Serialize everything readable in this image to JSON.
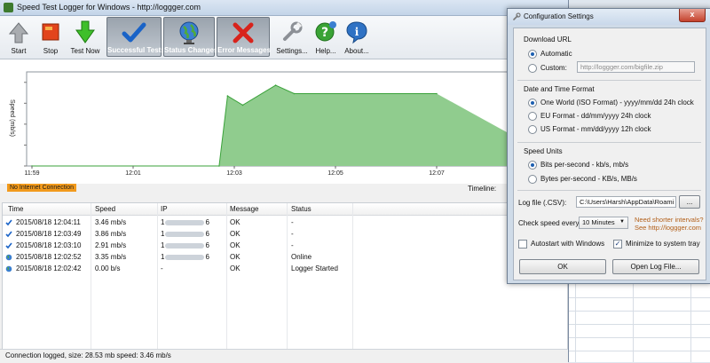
{
  "app": {
    "title": "Speed Test Logger for Windows - http://loggger.com"
  },
  "toolbar": {
    "buttons": [
      {
        "label": "Start",
        "icon": "start-icon"
      },
      {
        "label": "Stop",
        "icon": "stop-icon"
      },
      {
        "label": "Test Now",
        "icon": "test-now-icon"
      },
      {
        "label": "Successful Tests",
        "icon": "checkmark-icon"
      },
      {
        "label": "Status Changes",
        "icon": "globe-icon"
      },
      {
        "label": "Error Messages",
        "icon": "red-x-icon"
      },
      {
        "label": "Settings...",
        "icon": "wrench-icon"
      },
      {
        "label": "Help...",
        "icon": "help-icon"
      },
      {
        "label": "About...",
        "icon": "info-icon"
      }
    ]
  },
  "chart_data": {
    "type": "area",
    "ylabel": "Speed (mb/s)",
    "x": [
      "11:59",
      "12:01",
      "12:02:42",
      "12:02:52",
      "12:03:10",
      "12:03:49",
      "12:04:11",
      "12:05",
      "12:07"
    ],
    "x_ticks": [
      "11:59",
      "12:01",
      "12:03",
      "12:05",
      "12:07"
    ],
    "points": [
      {
        "t": "11:59",
        "v": 0
      },
      {
        "t": "12:02:42",
        "v": 0
      },
      {
        "t": "12:02:52",
        "v": 3.35
      },
      {
        "t": "12:03:10",
        "v": 2.91
      },
      {
        "t": "12:03:49",
        "v": 3.86
      },
      {
        "t": "12:04:11",
        "v": 3.46
      },
      {
        "t": "12:07",
        "v": 3.46
      }
    ],
    "ylim": [
      0,
      4.5
    ],
    "grid": false,
    "fill_color": "#90cc8e",
    "line_color": "#3aa23a"
  },
  "status": {
    "no_internet": "No Internet Connection",
    "timeline_label": "Timeline:",
    "statusbar_text": "Connection logged, size: 28.53 mb speed: 3.46 mb/s"
  },
  "table": {
    "headers": [
      "Time",
      "Speed",
      "IP",
      "Message",
      "Status"
    ],
    "rows": [
      {
        "icon": "check",
        "time": "2015/08/18 12:04:11",
        "speed": "3.46 mb/s",
        "ip_start": "1",
        "ip_end": "6",
        "message": "OK",
        "status": "-"
      },
      {
        "icon": "check",
        "time": "2015/08/18 12:03:49",
        "speed": "3.86 mb/s",
        "ip_start": "1",
        "ip_end": "6",
        "message": "OK",
        "status": "-"
      },
      {
        "icon": "check",
        "time": "2015/08/18 12:03:10",
        "speed": "2.91 mb/s",
        "ip_start": "1",
        "ip_end": "6",
        "message": "OK",
        "status": "-"
      },
      {
        "icon": "globe",
        "time": "2015/08/18 12:02:52",
        "speed": "3.35 mb/s",
        "ip_start": "1",
        "ip_end": "6",
        "message": "OK",
        "status": "Online"
      },
      {
        "icon": "globe",
        "time": "2015/08/18 12:02:42",
        "speed": "0.00 b/s",
        "ip_start": "-",
        "ip_end": "",
        "message": "OK",
        "status": "Logger Started"
      }
    ]
  },
  "config": {
    "title": "Configuration Settings",
    "close_label": "x",
    "download_url": {
      "group_label": "Download URL",
      "automatic_label": "Automatic",
      "custom_label": "Custom:",
      "custom_value": "http://loggger.com/bigfile.zip",
      "selected": "automatic"
    },
    "datetime": {
      "group_label": "Date and Time Format",
      "options": [
        "One World (ISO Format) - yyyy/mm/dd 24h clock",
        "EU Format - dd/mm/yyyy 24h clock",
        "US Format - mm/dd/yyyy 12h clock"
      ],
      "selected_index": 0
    },
    "units": {
      "group_label": "Speed Units",
      "options": [
        "Bits per-second - kb/s, mb/s",
        "Bytes per-second - KB/s, MB/s"
      ],
      "selected_index": 0
    },
    "log_file": {
      "label": "Log file (.CSV):",
      "value": "C:\\Users\\Harsh\\AppData\\Roami",
      "browse_label": "..."
    },
    "check_speed": {
      "label": "Check speed every:",
      "value": "10 Minutes",
      "link_line1": "Need shorter intervals?",
      "link_line2": "See http://loggger.com"
    },
    "autostart_label": "Autostart with Windows",
    "autostart_checked": false,
    "minimize_label": "Minimize to system tray",
    "minimize_checked": true,
    "ok_label": "OK",
    "open_log_label": "Open Log File..."
  }
}
